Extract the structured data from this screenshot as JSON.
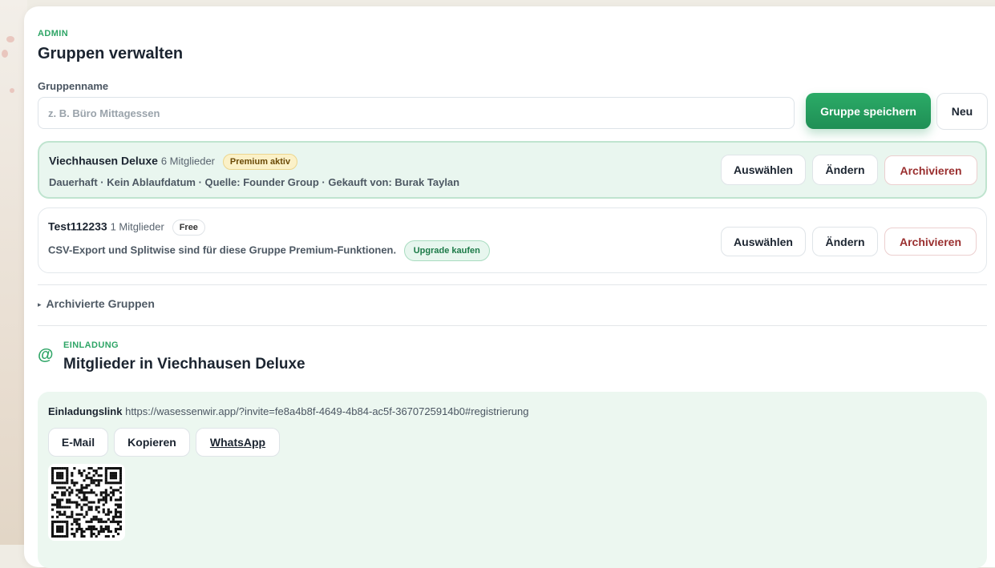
{
  "admin": {
    "eyebrow": "ADMIN",
    "title": "Gruppen verwalten",
    "group_name_label": "Gruppenname",
    "group_name_placeholder": "z. B. Büro Mittagessen",
    "group_name_value": "",
    "save_label": "Gruppe speichern",
    "new_label": "Neu"
  },
  "groups": [
    {
      "name": "Viechhausen Deluxe",
      "members": "6 Mitglieder",
      "badge": "Premium aktiv",
      "meta": "Dauerhaft · Kein Ablaufdatum · Quelle: Founder Group · Gekauft von: Burak Taylan",
      "select_label": "Auswählen",
      "edit_label": "Ändern",
      "archive_label": "Archivieren"
    },
    {
      "name": "Test112233",
      "members": "1 Mitglieder",
      "badge": "Free",
      "meta": "CSV-Export und Splitwise sind für diese Gruppe Premium-Funktionen.",
      "upgrade_label": "Upgrade kaufen",
      "select_label": "Auswählen",
      "edit_label": "Ändern",
      "archive_label": "Archivieren"
    }
  ],
  "archived": {
    "toggle_icon": "▸",
    "label": "Archivierte Gruppen"
  },
  "invite": {
    "icon": "@",
    "eyebrow": "EINLADUNG",
    "title": "Mitglieder in Viechhausen Deluxe",
    "link_label": "Einladungslink",
    "link_url": "https://wasessenwir.app/?invite=fe8a4b8f-4649-4b84-ac5f-3670725914b0#registrierung",
    "email_label": "E-Mail",
    "copy_label": "Kopieren",
    "whatsapp_label": "WhatsApp"
  },
  "colors": {
    "accent": "#2ea566",
    "primary_button": "#23995c",
    "danger": "#9a2f2f",
    "active_group_bg": "#e9f6ef",
    "invite_bg": "#ecf7f0"
  }
}
